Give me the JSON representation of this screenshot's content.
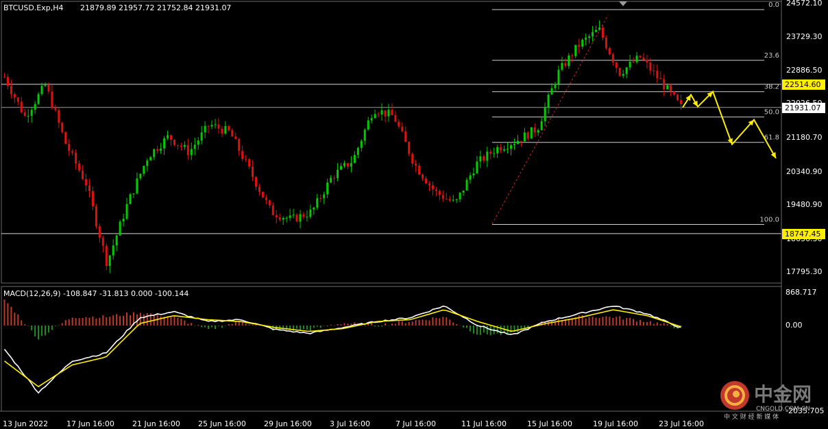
{
  "header": {
    "symbol": "BTCUSD.Exp,H4",
    "ohlc": "21879.89 21957.72 21752.84 21931.07"
  },
  "macd": {
    "label": "MACD(12,26,9) -108.847 -31.813 0.000 -100.144",
    "axis_labels": [
      "868.717",
      "0.00",
      "-2035.705"
    ]
  },
  "price_axis": {
    "ticks": [
      "24572.10",
      "23729.30",
      "22886.50",
      "22026.50",
      "21180.70",
      "20340.90",
      "19480.90",
      "18636.30",
      "17795.30"
    ],
    "markers": [
      {
        "value": "22514.60",
        "style": "yellow"
      },
      {
        "value": "21931.07",
        "style": "white"
      },
      {
        "value": "18747.45",
        "style": "yellow"
      }
    ]
  },
  "fib_levels": [
    "0.0",
    "23.6",
    "38.2",
    "50.0",
    "61.8",
    "100.0"
  ],
  "date_axis": [
    "13 Jun 2022",
    "17 Jun 16:00",
    "21 Jun 16:00",
    "25 Jun 16:00",
    "29 Jun 16:00",
    "3 Jul 16:00",
    "7 Jul 16:00",
    "11 Jul 16:00",
    "15 Jul 16:00",
    "19 Jul 16:00",
    "23 Jul 16:00"
  ],
  "watermark": {
    "name": "中金网",
    "domain": "CNGOLD.COM.CN",
    "tagline": "中 文 财 经 新 媒 体"
  },
  "colors": {
    "bull": "#00cc00",
    "bear": "#dd1111",
    "fib": "#d2d2d2",
    "projection": "#ffee00",
    "signal": "#ffee00",
    "macd_line": "#ffffff"
  },
  "chart_data": {
    "type": "candlestick",
    "instrument": "BTCUSD.Exp",
    "timeframe": "H4",
    "last_close": 21931.07,
    "horizontal_levels": [
      22514.6,
      18747.45
    ],
    "fibonacci": {
      "high": 24400,
      "low": 18980,
      "levels": [
        {
          "label": "0.0",
          "price": 24400
        },
        {
          "label": "23.6",
          "price": 23120
        },
        {
          "label": "38.2",
          "price": 22330
        },
        {
          "label": "50.0",
          "price": 21690
        },
        {
          "label": "61.8",
          "price": 21050
        },
        {
          "label": "100.0",
          "price": 18980
        }
      ]
    },
    "trend_anchors": [
      {
        "date": "13 Jun",
        "close": 22700
      },
      {
        "date": "14 Jun",
        "close": 21700
      },
      {
        "date": "15 Jun",
        "close": 22500
      },
      {
        "date": "16 Jun",
        "close": 21000
      },
      {
        "date": "17 Jun",
        "close": 20000
      },
      {
        "date": "18 Jun",
        "close": 18000
      },
      {
        "date": "19 Jun",
        "close": 19500
      },
      {
        "date": "20 Jun",
        "close": 20700
      },
      {
        "date": "21 Jun",
        "close": 21200
      },
      {
        "date": "23 Jun",
        "close": 20800
      },
      {
        "date": "25 Jun",
        "close": 21500
      },
      {
        "date": "27 Jun",
        "close": 21300
      },
      {
        "date": "29 Jun",
        "close": 20300
      },
      {
        "date": "30 Jun",
        "close": 19300
      },
      {
        "date": "1 Jul",
        "close": 19100
      },
      {
        "date": "3 Jul",
        "close": 19300
      },
      {
        "date": "5 Jul",
        "close": 20200
      },
      {
        "date": "6 Jul",
        "close": 20600
      },
      {
        "date": "7 Jul",
        "close": 21900
      },
      {
        "date": "9 Jul",
        "close": 21700
      },
      {
        "date": "11 Jul",
        "close": 20500
      },
      {
        "date": "12 Jul",
        "close": 19800
      },
      {
        "date": "13 Jul",
        "close": 19500
      },
      {
        "date": "14 Jul",
        "close": 20500
      },
      {
        "date": "15 Jul",
        "close": 20900
      },
      {
        "date": "16 Jul",
        "close": 21100
      },
      {
        "date": "17 Jul",
        "close": 21400
      },
      {
        "date": "18 Jul",
        "close": 22800
      },
      {
        "date": "19 Jul",
        "close": 23500
      },
      {
        "date": "20 Jul",
        "close": 23900
      },
      {
        "date": "21 Jul",
        "close": 22800
      },
      {
        "date": "22 Jul",
        "close": 23200
      },
      {
        "date": "23 Jul",
        "close": 22600
      },
      {
        "date": "24 Jul",
        "close": 21931
      }
    ],
    "projection": [
      {
        "point": 1,
        "price": 21931
      },
      {
        "point": 2,
        "price": 22250
      },
      {
        "point": 3,
        "price": 21950
      },
      {
        "point": 4,
        "price": 22330
      },
      {
        "point": 5,
        "price": 21000
      },
      {
        "point": 6,
        "price": 21620
      },
      {
        "point": 7,
        "price": 20650
      }
    ],
    "macd_series": {
      "macd_anchors": [
        -600,
        -1700,
        -900,
        -700,
        200,
        350,
        100,
        150,
        -100,
        -200,
        -50,
        100,
        200,
        500,
        0,
        -250,
        100,
        300,
        500,
        300,
        -60
      ],
      "signal_anchors": [
        -900,
        -1550,
        -1000,
        -800,
        50,
        250,
        150,
        100,
        -50,
        -150,
        -80,
        100,
        150,
        400,
        100,
        -150,
        50,
        200,
        400,
        250,
        -30
      ]
    }
  }
}
